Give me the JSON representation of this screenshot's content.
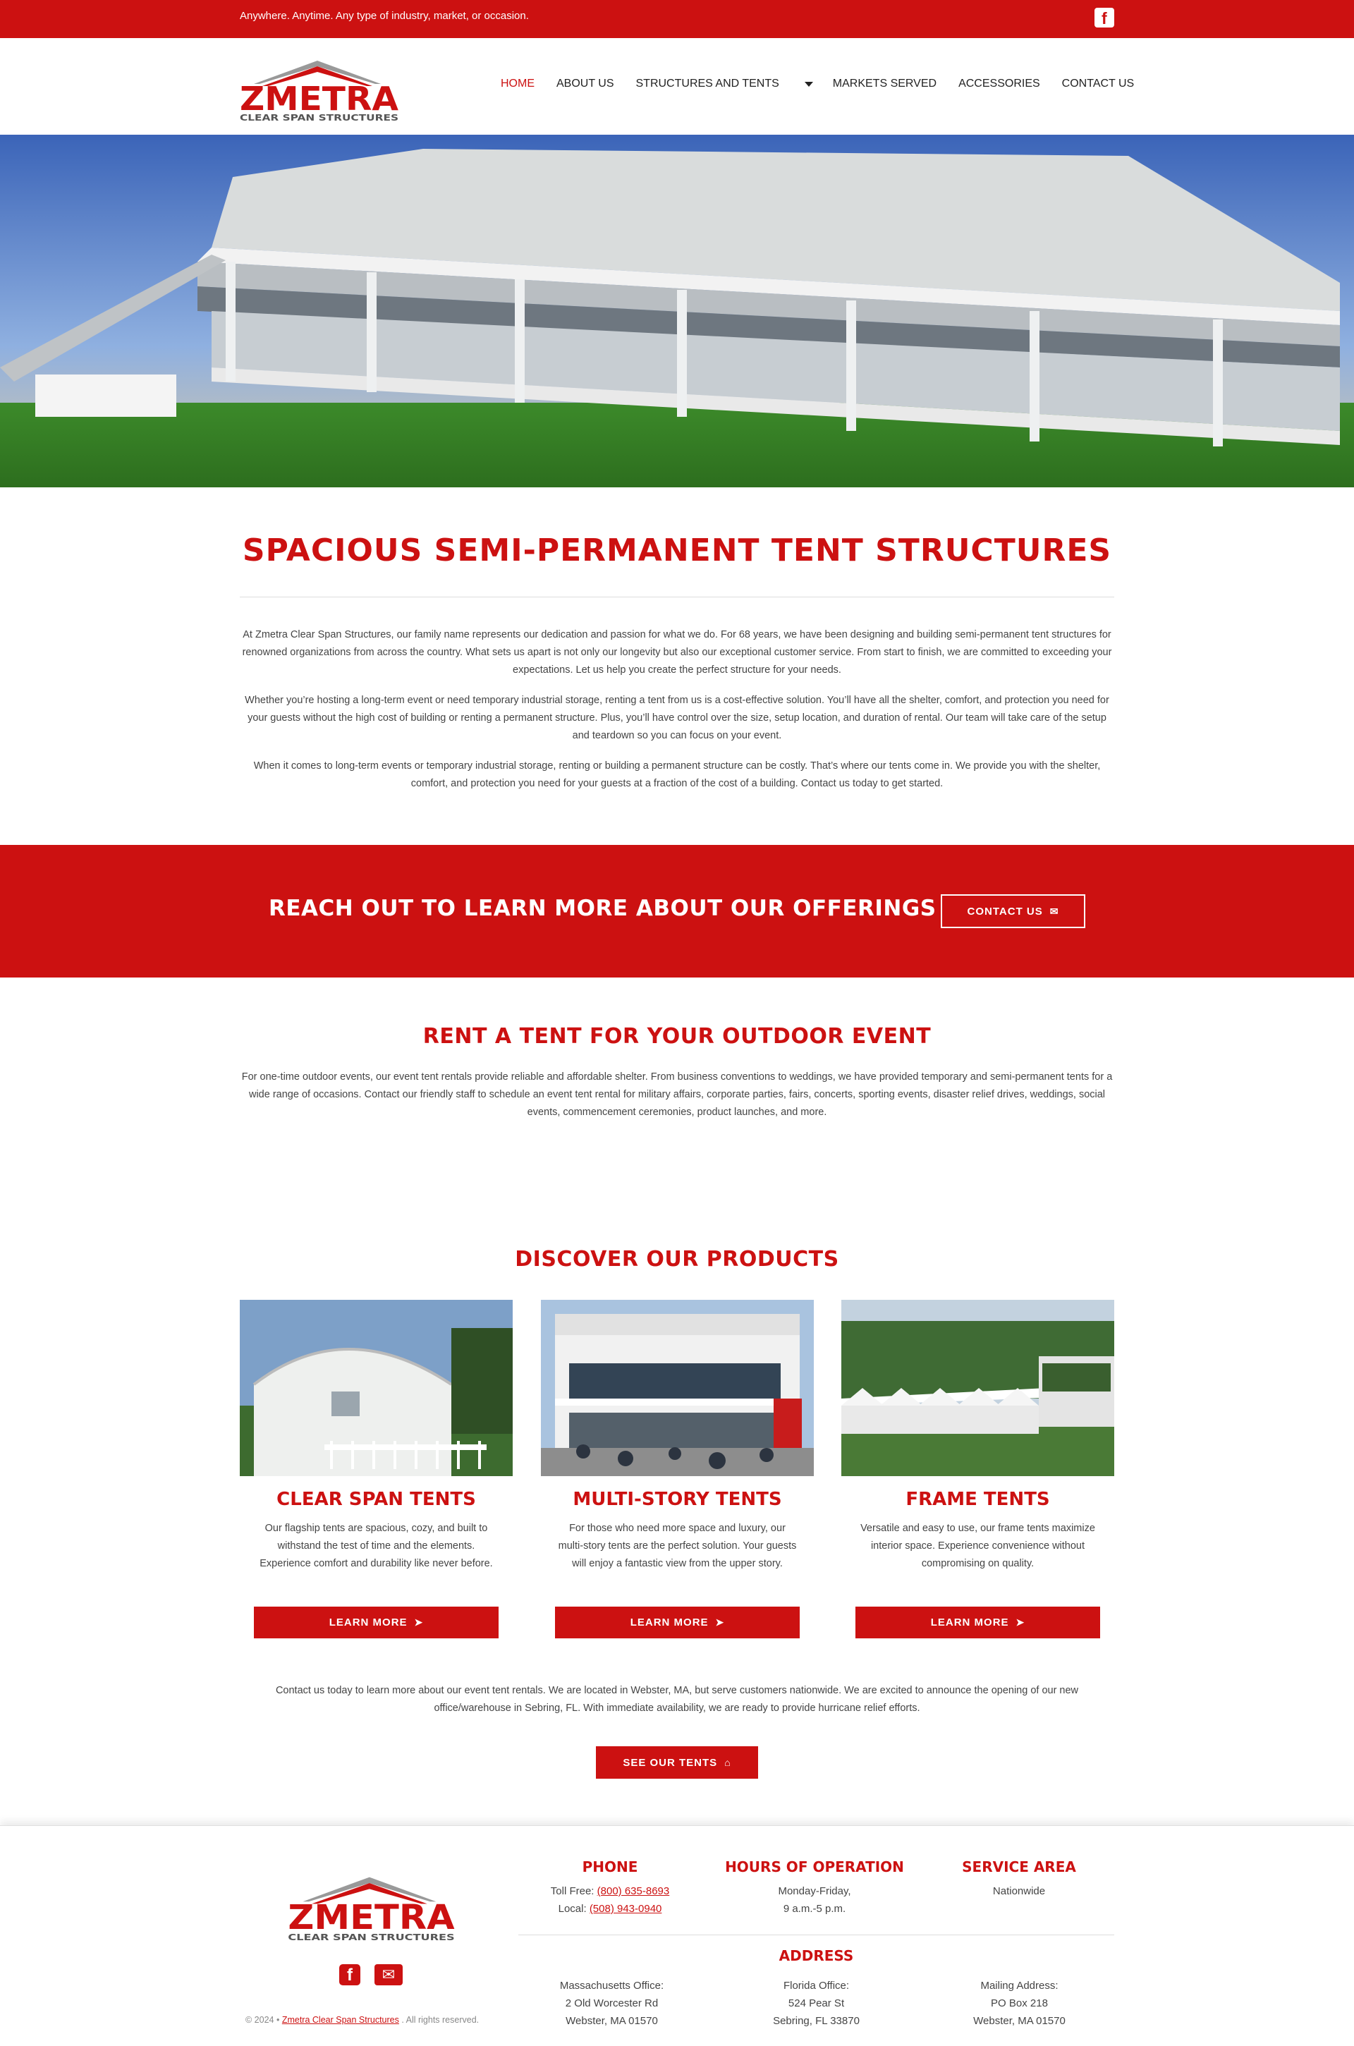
{
  "topbar": {
    "tagline": "Anywhere. Anytime. Any type of industry, market, or occasion.",
    "facebook_icon": "facebook-icon"
  },
  "logo": {
    "name": "ZMETRA",
    "sub": "CLEAR SPAN STRUCTURES"
  },
  "nav": {
    "home": "HOME",
    "about": "ABOUT US",
    "structures": "STRUCTURES AND TENTS",
    "markets": "MARKETS SERVED",
    "accessories": "ACCESSORIES",
    "contact": "CONTACT US"
  },
  "intro": {
    "title": "SPACIOUS SEMI-PERMANENT TENT STRUCTURES",
    "p1": "At Zmetra Clear Span Structures, our family name represents our dedication and passion for what we do. For 68 years, we have been designing and building semi-permanent tent structures for renowned organizations from across the country. What sets us apart is not only our longevity but also our exceptional customer service. From start to finish, we are committed to exceeding your expectations. Let us help you create the perfect structure for your needs.",
    "p2": "Whether you’re hosting a long-term event or need temporary industrial storage, renting a tent from us is a cost-effective solution. You’ll have all the shelter, comfort, and protection you need for your guests without the high cost of building or renting a permanent structure. Plus, you’ll have control over the size, setup location, and duration of rental. Our team will take care of the setup and teardown so you can focus on your event.",
    "p3": "When it comes to long-term events or temporary industrial storage, renting or building a permanent structure can be costly. That’s where our tents come in. We provide you with the shelter, comfort, and protection you need for your guests at a fraction of the cost of a building. Contact us today to get started."
  },
  "cta": {
    "title": "REACH OUT TO LEARN MORE ABOUT OUR OFFERINGS",
    "button": "CONTACT US",
    "icon": "envelope-icon"
  },
  "rent": {
    "title": "RENT A TENT FOR YOUR OUTDOOR EVENT",
    "text": "For one-time outdoor events, our event tent rentals provide reliable and affordable shelter. From business conventions to weddings, we have provided temporary and semi-permanent tents for a wide range of occasions. Contact our friendly staff to schedule an event tent rental for military affairs, corporate parties, fairs, concerts, sporting events, disaster relief drives, weddings, social events, commencement ceremonies, product launches, and more."
  },
  "products": {
    "title": "DISCOVER OUR PRODUCTS",
    "items": [
      {
        "title": "CLEAR SPAN TENTS",
        "desc": "Our flagship tents are spacious, cozy, and built to withstand the test of time and the elements. Experience comfort and durability like never before.",
        "button": "LEARN MORE"
      },
      {
        "title": "MULTI-STORY TENTS",
        "desc": "For those who need more space and luxury, our multi-story tents are the perfect solution. Your guests will enjoy a fantastic view from the upper story.",
        "button": "LEARN MORE"
      },
      {
        "title": "FRAME TENTS",
        "desc": "Versatile and easy to use, our frame tents maximize interior space. Experience convenience without compromising on quality.",
        "button": "LEARN MORE"
      }
    ],
    "note": "Contact us today to learn more about our event tent rentals. We are located in Webster, MA, but serve customers nationwide. We are excited to announce the opening of our new office/warehouse in Sebring, FL. With immediate availability, we are ready to provide hurricane relief efforts.",
    "see_button": "SEE OUR TENTS"
  },
  "footer": {
    "phone_head": "PHONE",
    "toll_label": "Toll Free:",
    "toll": "(800) 635-8693",
    "local_label": "Local:",
    "local": "(508) 943-0940",
    "hours_head": "HOURS OF OPERATION",
    "hours1": "Monday-Friday,",
    "hours2": "9 a.m.-5 p.m.",
    "area_head": "SERVICE AREA",
    "area": "Nationwide",
    "address_head": "ADDRESS",
    "ma_label": "Massachusetts Office:",
    "ma1": "2 Old Worcester Rd",
    "ma2": "Webster, MA 01570",
    "fl_label": "Florida Office:",
    "fl1": "524 Pear St",
    "fl2": "Sebring, FL 33870",
    "mail_label": "Mailing Address:",
    "mail1": "PO Box 218",
    "mail2": "Webster, MA 01570",
    "copy_prefix": "© 2024 •",
    "copy_link": "Zmetra Clear Span Structures",
    "copy_suffix": ". All rights reserved."
  },
  "colors": {
    "brand_red": "#cc1111",
    "text_dark": "#222222"
  }
}
